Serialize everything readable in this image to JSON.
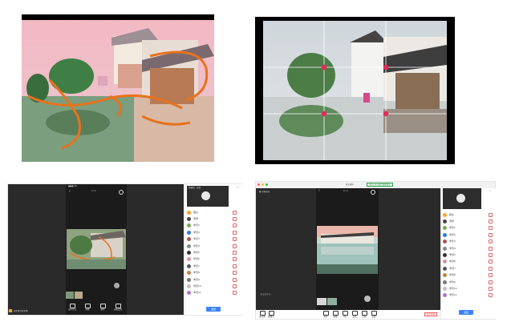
{
  "bottom_left": {
    "page_indicator": "2 / 2",
    "streamer_label": "天生我才必有用",
    "toolbar": [
      "无声音效",
      "画笔",
      "删除",
      "画板设置"
    ],
    "sidebar_header": "直播间 · 在线",
    "users": [
      {
        "name": "群主",
        "color": "#f5a623"
      },
      {
        "name": "老师",
        "color": "#444"
      },
      {
        "name": "学员1",
        "color": "#7a5"
      },
      {
        "name": "学员2",
        "color": "#2a7ae2"
      },
      {
        "name": "学员3",
        "color": "#a55"
      },
      {
        "name": "学员4",
        "color": "#888"
      },
      {
        "name": "学员5",
        "color": "#333"
      },
      {
        "name": "学员6",
        "color": "#c9a"
      },
      {
        "name": "学员7",
        "color": "#556"
      },
      {
        "name": "学员8",
        "color": "#b84"
      },
      {
        "name": "学员9",
        "color": "#777"
      },
      {
        "name": "学员10",
        "color": "#cbb"
      },
      {
        "name": "学员11",
        "color": "#a7c"
      }
    ],
    "send_button": "发送"
  },
  "bottom_right": {
    "window_title": "群直播中",
    "status_pill": "正在与1人进行屏幕共享",
    "page_indicator": "2 / 2",
    "toolbar": [
      "麦克风",
      "摄像头",
      "共享",
      "画笔",
      "评论",
      "成员",
      "白板",
      "设置"
    ],
    "end_button": "结束直播",
    "send_button": "发送",
    "users": [
      {
        "name": "群主",
        "color": "#f5a623"
      },
      {
        "name": "老师",
        "color": "#444"
      },
      {
        "name": "学员1",
        "color": "#7a5"
      },
      {
        "name": "学员2",
        "color": "#2a7ae2"
      },
      {
        "name": "学员3",
        "color": "#a55"
      },
      {
        "name": "学员4",
        "color": "#888"
      },
      {
        "name": "学员5",
        "color": "#333"
      },
      {
        "name": "学员6",
        "color": "#c9a"
      },
      {
        "name": "学员7",
        "color": "#556"
      },
      {
        "name": "学员8",
        "color": "#b84"
      },
      {
        "name": "学员9",
        "color": "#777"
      },
      {
        "name": "学员10",
        "color": "#cbb"
      },
      {
        "name": "学员11",
        "color": "#a7c"
      }
    ]
  }
}
